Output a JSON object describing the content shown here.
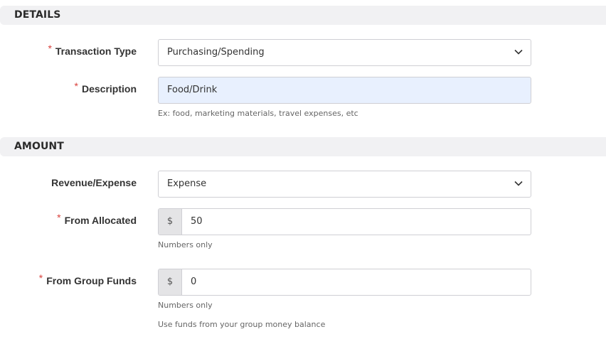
{
  "sections": {
    "details": {
      "title": "DETAILS"
    },
    "amount": {
      "title": "AMOUNT"
    }
  },
  "required_marker": "*",
  "fields": {
    "transaction_type": {
      "label": "Transaction Type",
      "required": true,
      "selected": "Purchasing/Spending",
      "icon": "chevron-down-icon"
    },
    "description": {
      "label": "Description",
      "required": true,
      "value": "Food/Drink",
      "help": "Ex: food, marketing materials, travel expenses, etc"
    },
    "revenue_expense": {
      "label": "Revenue/Expense",
      "required": false,
      "selected": "Expense",
      "icon": "chevron-down-icon"
    },
    "from_allocated": {
      "label": "From Allocated",
      "required": true,
      "prefix": "$",
      "value": "50",
      "help": "Numbers only"
    },
    "from_group_funds": {
      "label": "From Group Funds",
      "required": true,
      "prefix": "$",
      "value": "0",
      "help": "Numbers only",
      "help2": "Use funds from your group money balance"
    }
  },
  "colors": {
    "section_bg": "#f1f1f3",
    "required": "#d9413c",
    "autofill_bg": "#e8f0fe",
    "border": "#cfcfd4"
  }
}
